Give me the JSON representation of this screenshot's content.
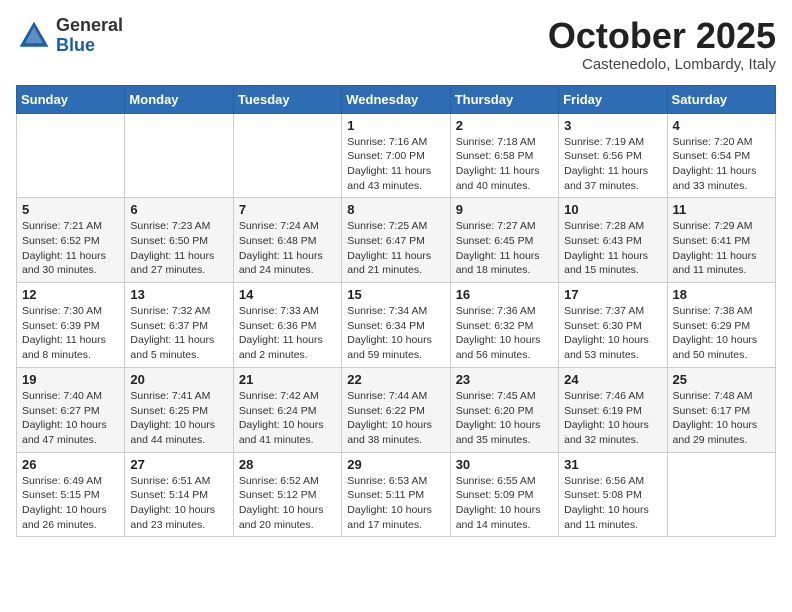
{
  "header": {
    "logo_general": "General",
    "logo_blue": "Blue",
    "month_title": "October 2025",
    "subtitle": "Castenedolo, Lombardy, Italy"
  },
  "calendar": {
    "weekdays": [
      "Sunday",
      "Monday",
      "Tuesday",
      "Wednesday",
      "Thursday",
      "Friday",
      "Saturday"
    ],
    "weeks": [
      [
        {
          "day": "",
          "info": ""
        },
        {
          "day": "",
          "info": ""
        },
        {
          "day": "",
          "info": ""
        },
        {
          "day": "1",
          "info": "Sunrise: 7:16 AM\nSunset: 7:00 PM\nDaylight: 11 hours\nand 43 minutes."
        },
        {
          "day": "2",
          "info": "Sunrise: 7:18 AM\nSunset: 6:58 PM\nDaylight: 11 hours\nand 40 minutes."
        },
        {
          "day": "3",
          "info": "Sunrise: 7:19 AM\nSunset: 6:56 PM\nDaylight: 11 hours\nand 37 minutes."
        },
        {
          "day": "4",
          "info": "Sunrise: 7:20 AM\nSunset: 6:54 PM\nDaylight: 11 hours\nand 33 minutes."
        }
      ],
      [
        {
          "day": "5",
          "info": "Sunrise: 7:21 AM\nSunset: 6:52 PM\nDaylight: 11 hours\nand 30 minutes."
        },
        {
          "day": "6",
          "info": "Sunrise: 7:23 AM\nSunset: 6:50 PM\nDaylight: 11 hours\nand 27 minutes."
        },
        {
          "day": "7",
          "info": "Sunrise: 7:24 AM\nSunset: 6:48 PM\nDaylight: 11 hours\nand 24 minutes."
        },
        {
          "day": "8",
          "info": "Sunrise: 7:25 AM\nSunset: 6:47 PM\nDaylight: 11 hours\nand 21 minutes."
        },
        {
          "day": "9",
          "info": "Sunrise: 7:27 AM\nSunset: 6:45 PM\nDaylight: 11 hours\nand 18 minutes."
        },
        {
          "day": "10",
          "info": "Sunrise: 7:28 AM\nSunset: 6:43 PM\nDaylight: 11 hours\nand 15 minutes."
        },
        {
          "day": "11",
          "info": "Sunrise: 7:29 AM\nSunset: 6:41 PM\nDaylight: 11 hours\nand 11 minutes."
        }
      ],
      [
        {
          "day": "12",
          "info": "Sunrise: 7:30 AM\nSunset: 6:39 PM\nDaylight: 11 hours\nand 8 minutes."
        },
        {
          "day": "13",
          "info": "Sunrise: 7:32 AM\nSunset: 6:37 PM\nDaylight: 11 hours\nand 5 minutes."
        },
        {
          "day": "14",
          "info": "Sunrise: 7:33 AM\nSunset: 6:36 PM\nDaylight: 11 hours\nand 2 minutes."
        },
        {
          "day": "15",
          "info": "Sunrise: 7:34 AM\nSunset: 6:34 PM\nDaylight: 10 hours\nand 59 minutes."
        },
        {
          "day": "16",
          "info": "Sunrise: 7:36 AM\nSunset: 6:32 PM\nDaylight: 10 hours\nand 56 minutes."
        },
        {
          "day": "17",
          "info": "Sunrise: 7:37 AM\nSunset: 6:30 PM\nDaylight: 10 hours\nand 53 minutes."
        },
        {
          "day": "18",
          "info": "Sunrise: 7:38 AM\nSunset: 6:29 PM\nDaylight: 10 hours\nand 50 minutes."
        }
      ],
      [
        {
          "day": "19",
          "info": "Sunrise: 7:40 AM\nSunset: 6:27 PM\nDaylight: 10 hours\nand 47 minutes."
        },
        {
          "day": "20",
          "info": "Sunrise: 7:41 AM\nSunset: 6:25 PM\nDaylight: 10 hours\nand 44 minutes."
        },
        {
          "day": "21",
          "info": "Sunrise: 7:42 AM\nSunset: 6:24 PM\nDaylight: 10 hours\nand 41 minutes."
        },
        {
          "day": "22",
          "info": "Sunrise: 7:44 AM\nSunset: 6:22 PM\nDaylight: 10 hours\nand 38 minutes."
        },
        {
          "day": "23",
          "info": "Sunrise: 7:45 AM\nSunset: 6:20 PM\nDaylight: 10 hours\nand 35 minutes."
        },
        {
          "day": "24",
          "info": "Sunrise: 7:46 AM\nSunset: 6:19 PM\nDaylight: 10 hours\nand 32 minutes."
        },
        {
          "day": "25",
          "info": "Sunrise: 7:48 AM\nSunset: 6:17 PM\nDaylight: 10 hours\nand 29 minutes."
        }
      ],
      [
        {
          "day": "26",
          "info": "Sunrise: 6:49 AM\nSunset: 5:15 PM\nDaylight: 10 hours\nand 26 minutes."
        },
        {
          "day": "27",
          "info": "Sunrise: 6:51 AM\nSunset: 5:14 PM\nDaylight: 10 hours\nand 23 minutes."
        },
        {
          "day": "28",
          "info": "Sunrise: 6:52 AM\nSunset: 5:12 PM\nDaylight: 10 hours\nand 20 minutes."
        },
        {
          "day": "29",
          "info": "Sunrise: 6:53 AM\nSunset: 5:11 PM\nDaylight: 10 hours\nand 17 minutes."
        },
        {
          "day": "30",
          "info": "Sunrise: 6:55 AM\nSunset: 5:09 PM\nDaylight: 10 hours\nand 14 minutes."
        },
        {
          "day": "31",
          "info": "Sunrise: 6:56 AM\nSunset: 5:08 PM\nDaylight: 10 hours\nand 11 minutes."
        },
        {
          "day": "",
          "info": ""
        }
      ]
    ]
  }
}
